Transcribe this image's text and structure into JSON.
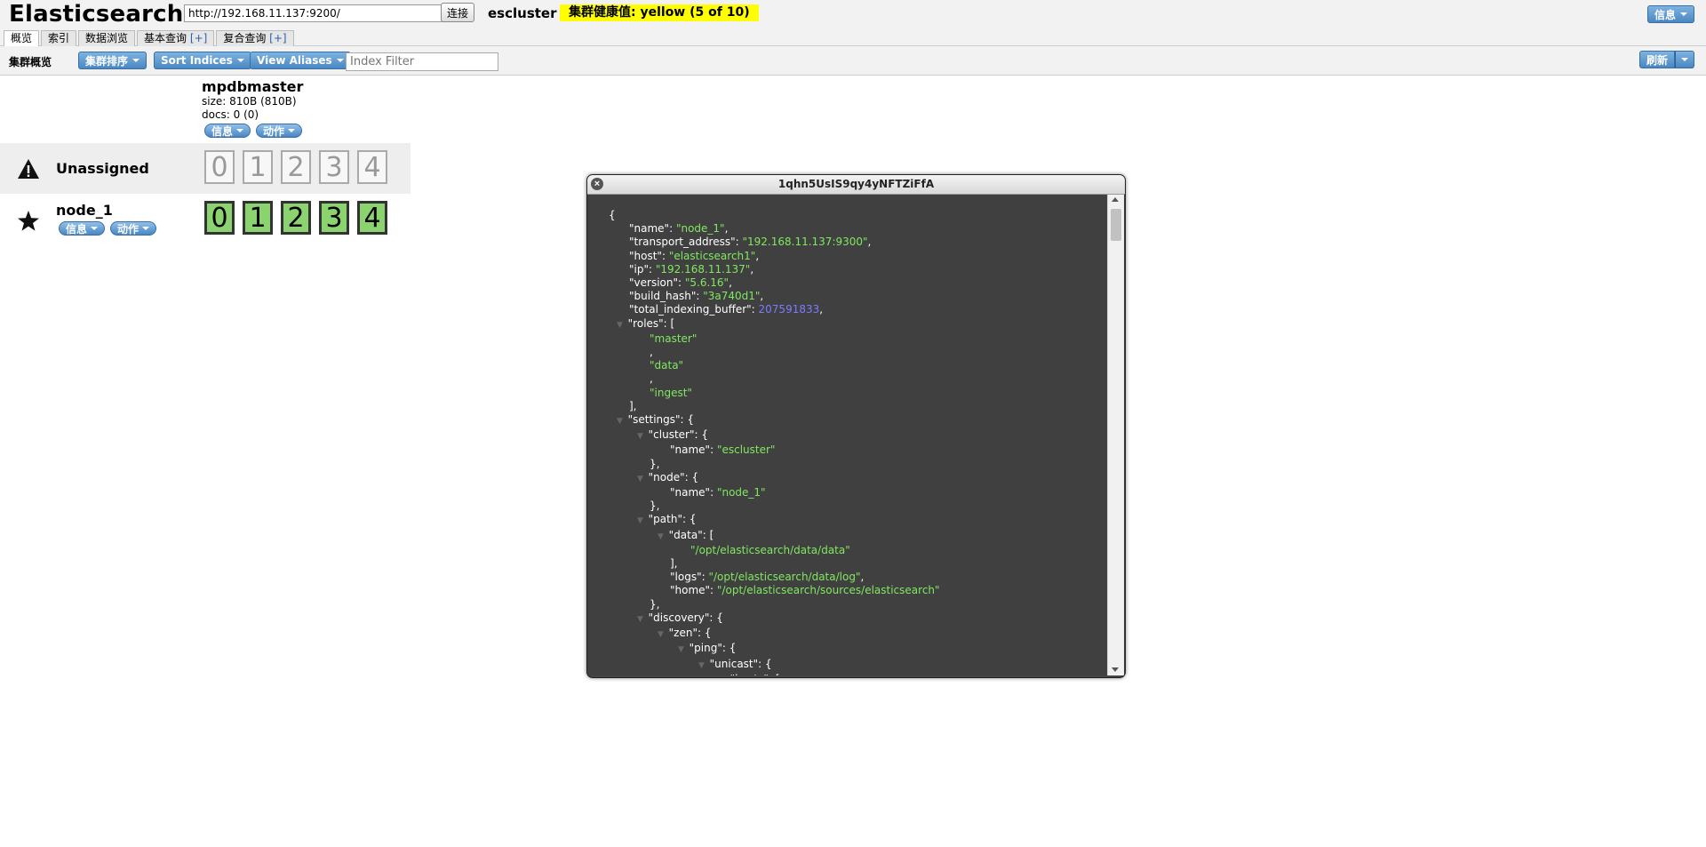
{
  "header": {
    "title": "Elasticsearch",
    "url": "http://192.168.11.137:9200/",
    "connect_label": "连接",
    "cluster_name": "escluster",
    "health": "集群健康值: yellow (5 of 10)",
    "info_label": "信息"
  },
  "tabs": [
    {
      "label": "概览",
      "plus": ""
    },
    {
      "label": "索引",
      "plus": ""
    },
    {
      "label": "数据浏览",
      "plus": ""
    },
    {
      "label": "基本查询",
      "plus": "[+]"
    },
    {
      "label": "复合查询",
      "plus": "[+]"
    }
  ],
  "toolbar": {
    "title": "集群概览",
    "sort_label": "集群排序",
    "indices_label": "Sort Indices",
    "aliases_label": "View Aliases",
    "filter_placeholder": "Index Filter",
    "refresh_label": "刷新"
  },
  "index": {
    "name": "mpdbmaster",
    "size": "size: 810B (810B)",
    "docs": "docs: 0 (0)",
    "info_label": "信息",
    "action_label": "动作"
  },
  "rows": {
    "unassigned_label": "Unassigned",
    "node_label": "node_1",
    "node_info_label": "信息",
    "node_action_label": "动作",
    "unassigned_shards": [
      "0",
      "1",
      "2",
      "3",
      "4"
    ],
    "node_shards": [
      "0",
      "1",
      "2",
      "3",
      "4"
    ]
  },
  "modal": {
    "title": "1qhn5UsIS9qy4yNFTZiFfA",
    "lines": [
      {
        "indent": 0,
        "tri": false,
        "parts": [
          {
            "t": "p",
            "v": "{"
          }
        ]
      },
      {
        "indent": 1,
        "tri": false,
        "parts": [
          {
            "t": "k",
            "v": "\"name\": "
          },
          {
            "t": "s",
            "v": "\"node_1\""
          },
          {
            "t": "p",
            "v": ","
          }
        ]
      },
      {
        "indent": 1,
        "tri": false,
        "parts": [
          {
            "t": "k",
            "v": "\"transport_address\": "
          },
          {
            "t": "s",
            "v": "\"192.168.11.137:9300\""
          },
          {
            "t": "p",
            "v": ","
          }
        ]
      },
      {
        "indent": 1,
        "tri": false,
        "parts": [
          {
            "t": "k",
            "v": "\"host\": "
          },
          {
            "t": "s",
            "v": "\"elasticsearch1\""
          },
          {
            "t": "p",
            "v": ","
          }
        ]
      },
      {
        "indent": 1,
        "tri": false,
        "parts": [
          {
            "t": "k",
            "v": "\"ip\": "
          },
          {
            "t": "s",
            "v": "\"192.168.11.137\""
          },
          {
            "t": "p",
            "v": ","
          }
        ]
      },
      {
        "indent": 1,
        "tri": false,
        "parts": [
          {
            "t": "k",
            "v": "\"version\": "
          },
          {
            "t": "s",
            "v": "\"5.6.16\""
          },
          {
            "t": "p",
            "v": ","
          }
        ]
      },
      {
        "indent": 1,
        "tri": false,
        "parts": [
          {
            "t": "k",
            "v": "\"build_hash\": "
          },
          {
            "t": "s",
            "v": "\"3a740d1\""
          },
          {
            "t": "p",
            "v": ","
          }
        ]
      },
      {
        "indent": 1,
        "tri": false,
        "parts": [
          {
            "t": "k",
            "v": "\"total_indexing_buffer\": "
          },
          {
            "t": "n",
            "v": "207591833"
          },
          {
            "t": "p",
            "v": ","
          }
        ]
      },
      {
        "indent": 1,
        "tri": true,
        "parts": [
          {
            "t": "k",
            "v": "\"roles\": ["
          }
        ]
      },
      {
        "indent": 2,
        "tri": false,
        "parts": [
          {
            "t": "s",
            "v": "\"master\""
          }
        ]
      },
      {
        "indent": 2,
        "tri": false,
        "parts": [
          {
            "t": "p",
            "v": ","
          }
        ]
      },
      {
        "indent": 2,
        "tri": false,
        "parts": [
          {
            "t": "s",
            "v": "\"data\""
          }
        ]
      },
      {
        "indent": 2,
        "tri": false,
        "parts": [
          {
            "t": "p",
            "v": ","
          }
        ]
      },
      {
        "indent": 2,
        "tri": false,
        "parts": [
          {
            "t": "s",
            "v": "\"ingest\""
          }
        ]
      },
      {
        "indent": 1,
        "tri": false,
        "parts": [
          {
            "t": "p",
            "v": "],"
          }
        ]
      },
      {
        "indent": 1,
        "tri": true,
        "parts": [
          {
            "t": "k",
            "v": "\"settings\": {"
          }
        ]
      },
      {
        "indent": 2,
        "tri": true,
        "parts": [
          {
            "t": "k",
            "v": "\"cluster\": {"
          }
        ]
      },
      {
        "indent": 3,
        "tri": false,
        "parts": [
          {
            "t": "k",
            "v": "\"name\": "
          },
          {
            "t": "s",
            "v": "\"escluster\""
          }
        ]
      },
      {
        "indent": 2,
        "tri": false,
        "parts": [
          {
            "t": "p",
            "v": "},"
          }
        ]
      },
      {
        "indent": 2,
        "tri": true,
        "parts": [
          {
            "t": "k",
            "v": "\"node\": {"
          }
        ]
      },
      {
        "indent": 3,
        "tri": false,
        "parts": [
          {
            "t": "k",
            "v": "\"name\": "
          },
          {
            "t": "s",
            "v": "\"node_1\""
          }
        ]
      },
      {
        "indent": 2,
        "tri": false,
        "parts": [
          {
            "t": "p",
            "v": "},"
          }
        ]
      },
      {
        "indent": 2,
        "tri": true,
        "parts": [
          {
            "t": "k",
            "v": "\"path\": {"
          }
        ]
      },
      {
        "indent": 3,
        "tri": true,
        "parts": [
          {
            "t": "k",
            "v": "\"data\": ["
          }
        ]
      },
      {
        "indent": 4,
        "tri": false,
        "parts": [
          {
            "t": "s",
            "v": "\"/opt/elasticsearch/data/data\""
          }
        ]
      },
      {
        "indent": 3,
        "tri": false,
        "parts": [
          {
            "t": "p",
            "v": "],"
          }
        ]
      },
      {
        "indent": 3,
        "tri": false,
        "parts": [
          {
            "t": "k",
            "v": "\"logs\": "
          },
          {
            "t": "s",
            "v": "\"/opt/elasticsearch/data/log\""
          },
          {
            "t": "p",
            "v": ","
          }
        ]
      },
      {
        "indent": 3,
        "tri": false,
        "parts": [
          {
            "t": "k",
            "v": "\"home\": "
          },
          {
            "t": "s",
            "v": "\"/opt/elasticsearch/sources/elasticsearch\""
          }
        ]
      },
      {
        "indent": 2,
        "tri": false,
        "parts": [
          {
            "t": "p",
            "v": "},"
          }
        ]
      },
      {
        "indent": 2,
        "tri": true,
        "parts": [
          {
            "t": "k",
            "v": "\"discovery\": {"
          }
        ]
      },
      {
        "indent": 3,
        "tri": true,
        "parts": [
          {
            "t": "k",
            "v": "\"zen\": {"
          }
        ]
      },
      {
        "indent": 4,
        "tri": true,
        "parts": [
          {
            "t": "k",
            "v": "\"ping\": {"
          }
        ]
      },
      {
        "indent": 5,
        "tri": true,
        "parts": [
          {
            "t": "k",
            "v": "\"unicast\": {"
          }
        ]
      },
      {
        "indent": 6,
        "tri": true,
        "parts": [
          {
            "t": "k",
            "v": "\"hosts\": ["
          }
        ]
      }
    ]
  }
}
